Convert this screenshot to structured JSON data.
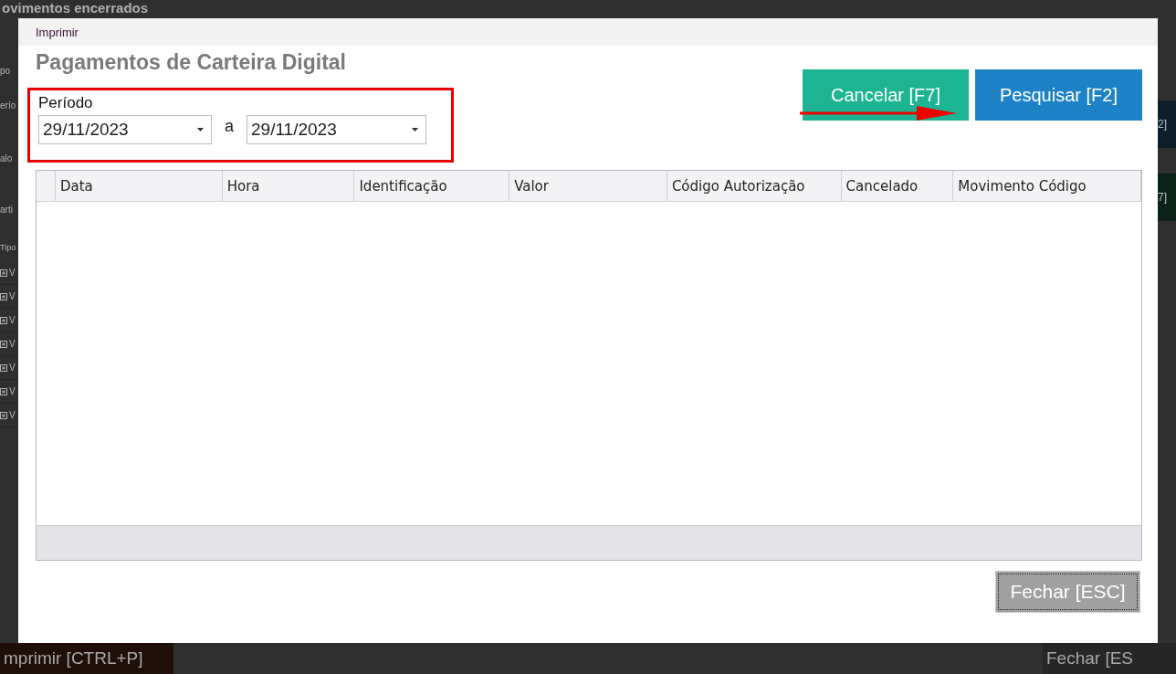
{
  "background": {
    "title": "ovimentos encerrados",
    "left_labels": [
      "po",
      "erío",
      "alo",
      "arti"
    ],
    "tree_header": "Tipo",
    "tree_rows": [
      {
        "label": "V",
        "expanded": false
      },
      {
        "label": "V",
        "expanded": false
      },
      {
        "label": "V",
        "expanded": false
      },
      {
        "label": "V",
        "expanded": false
      },
      {
        "label": "V",
        "expanded": false
      },
      {
        "label": "V",
        "expanded": false
      },
      {
        "label": "V",
        "expanded": false
      }
    ],
    "right_buttons": [
      "2]",
      "7]"
    ],
    "bottom_buttons": [
      {
        "label": "mprimir [CTRL+P]",
        "kind": "print"
      },
      {
        "label": "Fechar [ES",
        "kind": "close"
      }
    ]
  },
  "dialog": {
    "title": "Imprimir",
    "heading": "Pagamentos de Carteira Digital",
    "period": {
      "label": "Período",
      "from": "29/11/2023",
      "separator": "a",
      "to": "29/11/2023"
    },
    "buttons": [
      {
        "label": "Cancelar [F7]",
        "kind": "cancel"
      },
      {
        "label": "Pesquisar [F2]",
        "kind": "search"
      }
    ],
    "table": {
      "columns": [
        "Data",
        "Hora",
        "Identificação",
        "Valor",
        "Código Autorização",
        "Cancelado",
        "Movimento Código"
      ]
    },
    "close_button": "Fechar [ESC]"
  }
}
